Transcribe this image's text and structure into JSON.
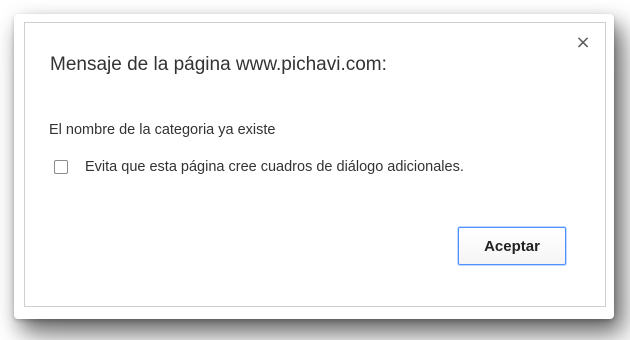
{
  "dialog": {
    "title": "Mensaje de la página www.pichavi.com:",
    "close_icon": "×",
    "message": "El nombre de la categoria ya existe",
    "suppress_checkbox": {
      "label": "Evita que esta página cree cuadros de diálogo adicionales.",
      "checked": false
    },
    "accept_label": "Aceptar"
  },
  "colors": {
    "focus_border": "#4d90fe",
    "text": "#333333"
  }
}
